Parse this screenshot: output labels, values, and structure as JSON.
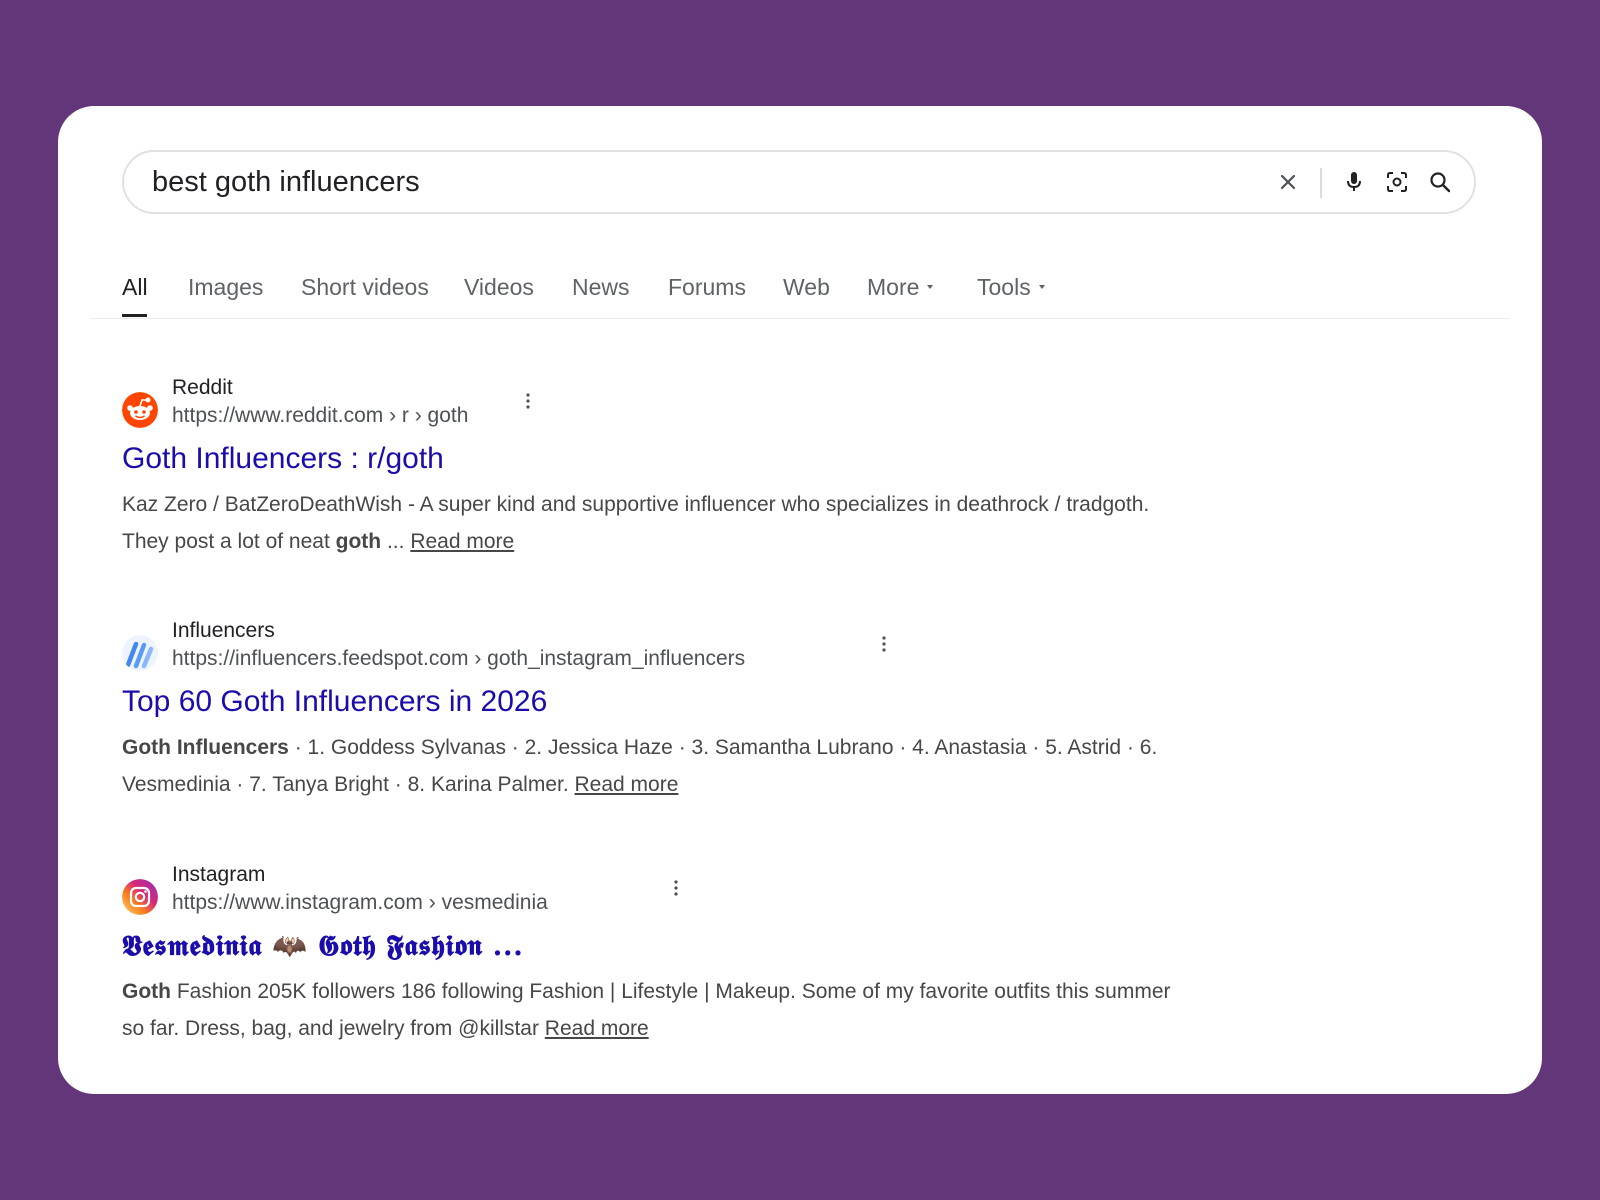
{
  "search": {
    "query": "best goth influencers"
  },
  "icons": {
    "clear": "close-icon",
    "voice": "microphone-icon",
    "lens": "camera-lens-icon",
    "search": "search-icon"
  },
  "tabs": [
    {
      "label": "All",
      "active": true
    },
    {
      "label": "Images"
    },
    {
      "label": "Short videos"
    },
    {
      "label": "Videos"
    },
    {
      "label": "News"
    },
    {
      "label": "Forums"
    },
    {
      "label": "Web"
    },
    {
      "label": "More",
      "dropdown": true
    },
    {
      "label": "Tools",
      "dropdown": true
    }
  ],
  "results": [
    {
      "site": "Reddit",
      "url": "https://www.reddit.com › r › goth",
      "title": "Goth Influencers : r/goth",
      "snippet_before": "Kaz Zero / BatZeroDeathWish - A super kind and supportive influencer who specializes in deathrock / tradgoth. They post a lot of neat ",
      "snippet_bold": "goth",
      "snippet_after": " ... ",
      "read_more": "Read more",
      "icon": "reddit-logo-icon",
      "icon_color": "#ff4500"
    },
    {
      "site": "Influencers",
      "url": "https://influencers.feedspot.com › goth_instagram_influencers",
      "title": "Top 60 Goth Influencers in 2026",
      "snippet_bold": "Goth Influencers",
      "snippet_after": " · 1. Goddess Sylvanas · 2. Jessica Haze · 3. Samantha Lubrano · 4. Anastasia · 5. Astrid · 6. Vesmedinia · 7. Tanya Bright · 8. Karina Palmer. ",
      "read_more": "Read more",
      "icon": "feedspot-logo-icon",
      "icon_color": "#4285f4"
    },
    {
      "site": "Instagram",
      "url": "https://www.instagram.com › vesmedinia",
      "title": "𝖁𝖊𝖘𝖒𝖊𝖉𝖎𝖓𝖎𝖆 🦇 𝕲𝖔𝖙𝖍 𝕱𝖆𝖘𝖍𝖎𝖔𝖓 ...",
      "snippet_bold": "Goth",
      "snippet_after": " Fashion 205K followers 186 following Fashion | Lifestyle | Makeup. Some of my favorite outfits this summer so far. Dress, bag, and jewelry from @killstar ",
      "read_more": "Read more",
      "icon": "instagram-logo-icon",
      "icon_color": "#e1306c"
    }
  ],
  "colors": {
    "background": "#633579",
    "link": "#1a0dab",
    "text": "#202124"
  }
}
